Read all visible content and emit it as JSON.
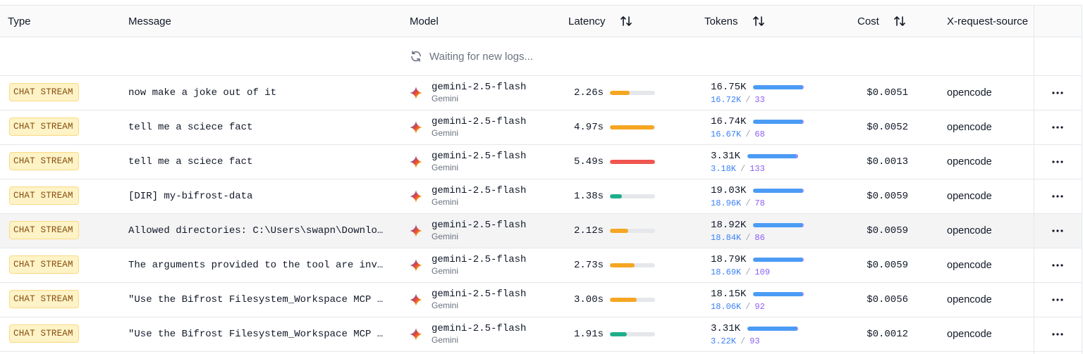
{
  "columns": {
    "type": "Type",
    "message": "Message",
    "model": "Model",
    "latency": "Latency",
    "tokens": "Tokens",
    "cost": "Cost",
    "source": "X-request-source"
  },
  "waiting_text": "Waiting for new logs...",
  "icons": {
    "sort": "sort-arrows-icon",
    "waiting": "refresh-icon",
    "model": "gemini-sparkle-icon",
    "more": "more-horizontal-icon"
  },
  "colors": {
    "latency_fast": "#1fae8c",
    "latency_medium": "#f5a623",
    "latency_slow": "#f0564f",
    "tokens_input": "#4b9bf5",
    "tokens_output": "#a78bfa",
    "badge_bg": "#fef3c7"
  },
  "rows": [
    {
      "type": "CHAT STREAM",
      "message": "now make a joke out of it",
      "model": "gemini-2.5-flash",
      "provider": "Gemini",
      "latency": "2.26s",
      "latency_fraction": 0.43,
      "latency_color": "#f5a623",
      "tokens_total": "16.75K",
      "tokens_in": "16.72K",
      "tokens_out": "33",
      "tokens_total_fraction": 1.0,
      "cost": "$0.0051",
      "source": "opencode",
      "highlight": false
    },
    {
      "type": "CHAT STREAM",
      "message": "tell me a sciece fact",
      "model": "gemini-2.5-flash",
      "provider": "Gemini",
      "latency": "4.97s",
      "latency_fraction": 0.99,
      "latency_color": "#f5a623",
      "tokens_total": "16.74K",
      "tokens_in": "16.67K",
      "tokens_out": "68",
      "tokens_total_fraction": 1.0,
      "cost": "$0.0052",
      "source": "opencode",
      "highlight": false
    },
    {
      "type": "CHAT STREAM",
      "message": "tell me a sciece fact",
      "model": "gemini-2.5-flash",
      "provider": "Gemini",
      "latency": "5.49s",
      "latency_fraction": 1.0,
      "latency_color": "#f0564f",
      "tokens_total": "3.31K",
      "tokens_in": "3.18K",
      "tokens_out": "133",
      "tokens_total_fraction": 1.0,
      "cost": "$0.0013",
      "source": "opencode",
      "highlight": false
    },
    {
      "type": "CHAT STREAM",
      "message": "[DIR] my-bifrost-data",
      "model": "gemini-2.5-flash",
      "provider": "Gemini",
      "latency": "1.38s",
      "latency_fraction": 0.26,
      "latency_color": "#1fae8c",
      "tokens_total": "19.03K",
      "tokens_in": "18.96K",
      "tokens_out": "78",
      "tokens_total_fraction": 1.0,
      "cost": "$0.0059",
      "source": "opencode",
      "highlight": false
    },
    {
      "type": "CHAT STREAM",
      "message": "Allowed directories: C:\\Users\\swapn\\Downloads",
      "model": "gemini-2.5-flash",
      "provider": "Gemini",
      "latency": "2.12s",
      "latency_fraction": 0.4,
      "latency_color": "#f5a623",
      "tokens_total": "18.92K",
      "tokens_in": "18.84K",
      "tokens_out": "86",
      "tokens_total_fraction": 1.0,
      "cost": "$0.0059",
      "source": "opencode",
      "highlight": true
    },
    {
      "type": "CHAT STREAM",
      "message": "The arguments provided to the tool are invalid",
      "model": "gemini-2.5-flash",
      "provider": "Gemini",
      "latency": "2.73s",
      "latency_fraction": 0.55,
      "latency_color": "#f5a623",
      "tokens_total": "18.79K",
      "tokens_in": "18.69K",
      "tokens_out": "109",
      "tokens_total_fraction": 1.0,
      "cost": "$0.0059",
      "source": "opencode",
      "highlight": false
    },
    {
      "type": "CHAT STREAM",
      "message": "\"Use the Bifrost Filesystem_Workspace MCP tool",
      "model": "gemini-2.5-flash",
      "provider": "Gemini",
      "latency": "3.00s",
      "latency_fraction": 0.6,
      "latency_color": "#f5a623",
      "tokens_total": "18.15K",
      "tokens_in": "18.06K",
      "tokens_out": "92",
      "tokens_total_fraction": 1.0,
      "cost": "$0.0056",
      "source": "opencode",
      "highlight": false
    },
    {
      "type": "CHAT STREAM",
      "message": "\"Use the Bifrost Filesystem_Workspace MCP tool",
      "model": "gemini-2.5-flash",
      "provider": "Gemini",
      "latency": "1.91s",
      "latency_fraction": 0.38,
      "latency_color": "#1fae8c",
      "tokens_total": "3.31K",
      "tokens_in": "3.22K",
      "tokens_out": "93",
      "tokens_total_fraction": 1.0,
      "cost": "$0.0012",
      "source": "opencode",
      "highlight": false
    }
  ]
}
